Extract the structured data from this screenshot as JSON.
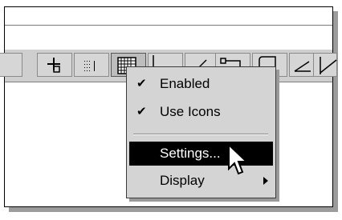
{
  "menu": {
    "items": [
      {
        "label": "Enabled",
        "checked_mark": "✔"
      },
      {
        "label": "Use Icons",
        "checked_mark": "✔"
      },
      {
        "label": "Settings..."
      },
      {
        "label": "Display"
      }
    ]
  },
  "toolbar": {
    "buttons": [
      {
        "icon": "snap-icon"
      },
      {
        "icon": "grid-dots-icon"
      },
      {
        "icon": "grid-icon",
        "pressed": true
      },
      {
        "icon": "ortho-icon"
      },
      {
        "icon": "polar-icon"
      },
      {
        "icon": "osnap-icon"
      },
      {
        "icon": "otrack-icon"
      },
      {
        "icon": "angle-icon"
      },
      {
        "icon": "dimension-icon"
      }
    ]
  },
  "colors": {
    "highlight": "#000000",
    "menu_bg": "#d4d4d4",
    "toolbar_bg": "#cfcfcf"
  }
}
